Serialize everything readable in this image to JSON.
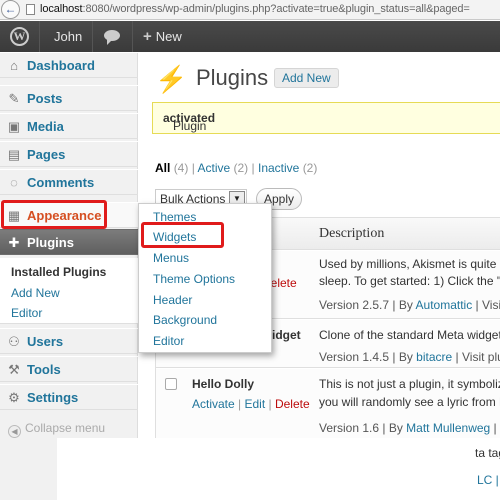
{
  "browser": {
    "host": "localhost",
    "url_rest": ":8080/wordpress/wp-admin/plugins.php?activate=true&plugin_status=all&paged=",
    "back_icon": "back-arrow-icon"
  },
  "adminbar": {
    "logo": "W",
    "user": "John",
    "new_label": "New"
  },
  "sidebar": {
    "items": [
      {
        "label": "Dashboard",
        "icon": "⌂"
      },
      {
        "label": "Posts",
        "icon": "✎"
      },
      {
        "label": "Media",
        "icon": "▣"
      },
      {
        "label": "Pages",
        "icon": "▤"
      },
      {
        "label": "Comments",
        "icon": "◌"
      },
      {
        "label": "Appearance",
        "icon": "▦"
      },
      {
        "label": "Plugins",
        "icon": "✚"
      },
      {
        "label": "Users",
        "icon": "⚇"
      },
      {
        "label": "Tools",
        "icon": "⚒"
      },
      {
        "label": "Settings",
        "icon": "⚙"
      }
    ],
    "plugins_submenu": [
      "Installed Plugins",
      "Add New",
      "Editor"
    ],
    "collapse": "Collapse menu"
  },
  "flyout": {
    "items": [
      "Themes",
      "Widgets",
      "Menus",
      "Theme Options",
      "Header",
      "Background",
      "Editor"
    ]
  },
  "main": {
    "title": "Plugins",
    "add_new": "Add New",
    "notice_prefix": "Plugin ",
    "notice_bold": "activated",
    "notice_suffix": ".",
    "views": {
      "all": "All",
      "all_count": "(4)",
      "active": "Active",
      "active_count": "(2)",
      "inactive": "Inactive",
      "inactive_count": "(2)"
    },
    "bulk_actions": "Bulk Actions",
    "apply": "Apply",
    "col_description": "Description"
  },
  "plugins": [
    {
      "actions_tail": "Delete",
      "desc1": "Used by millions, Akismet is quite p",
      "desc2": "sleep. To get started: 1) Click the \"A",
      "version": "Version 2.5.7 | By ",
      "author": "Automattic",
      "visit": " | Visit p"
    },
    {
      "name_tail": "idget",
      "desc1": "Clone of the standard Meta widget v",
      "version": "Version 1.4.5 | By ",
      "author": "bitacre",
      "visit": " | Visit plug"
    },
    {
      "name": "Hello Dolly",
      "activate": "Activate",
      "edit": "Edit",
      "delete": "Delete",
      "desc1": "This is not just a plugin, it symboliz",
      "desc2": "you will randomly see a lyric from H",
      "version": "Version 1.6 | By ",
      "author": "Matt Mullenweg",
      "visit": " | Vis"
    }
  ],
  "fragments": {
    "f1": "ta tag",
    "f2": "LC |"
  },
  "colors": {
    "highlight": "#e01b1b",
    "link": "#21759b",
    "adminbar": "#464646"
  }
}
